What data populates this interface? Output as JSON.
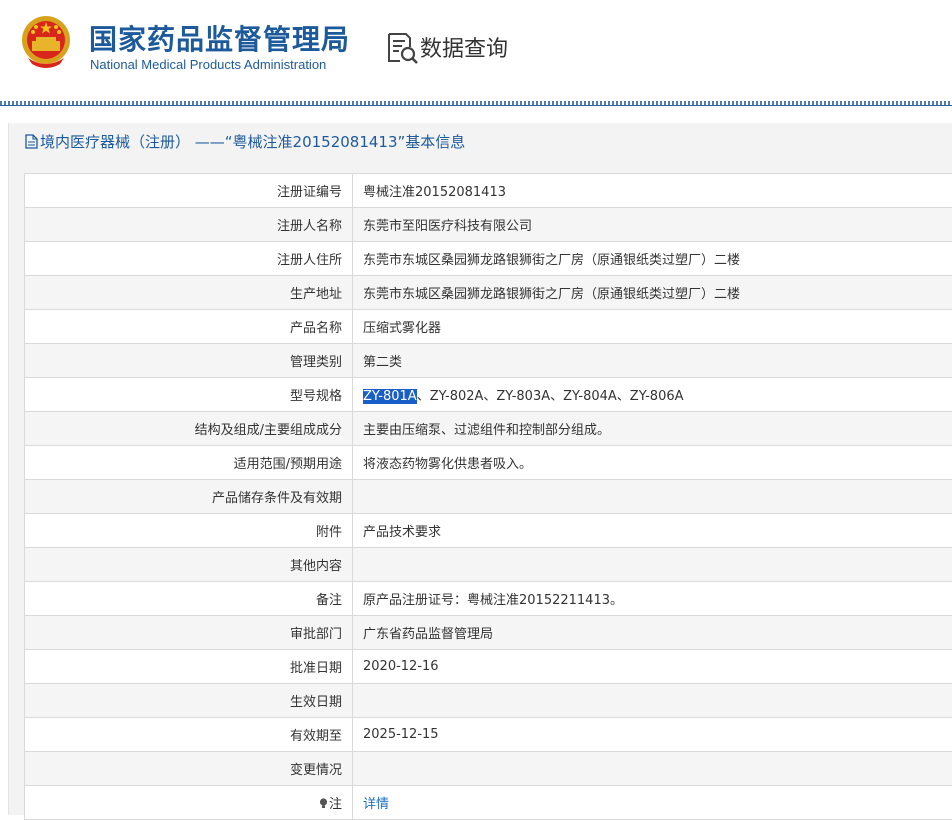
{
  "header": {
    "title_cn": "国家药品监督管理局",
    "title_en": "National Medical Products Administration",
    "query_label": "数据查询"
  },
  "colors": {
    "brand": "#1d5a9c",
    "link": "#1a6fc2",
    "highlight": "#1a5fc7"
  },
  "icons": {
    "emblem": "national-emblem",
    "query": "document-search-icon",
    "doc": "document-icon",
    "bulb": "lightbulb-icon"
  },
  "panel": {
    "title": "境内医疗器械（注册） ——“粤械注准20152081413”基本信息"
  },
  "rows": [
    {
      "label": "注册证编号",
      "value": "粤械注准20152081413"
    },
    {
      "label": "注册人名称",
      "value": "东莞市至阳医疗科技有限公司"
    },
    {
      "label": "注册人住所",
      "value": "东莞市东城区桑园狮龙路银狮街之厂房（原通银纸类过塑厂）二楼"
    },
    {
      "label": "生产地址",
      "value": "东莞市东城区桑园狮龙路银狮街之厂房（原通银纸类过塑厂）二楼"
    },
    {
      "label": "产品名称",
      "value": "压缩式雾化器"
    },
    {
      "label": "管理类别",
      "value": "第二类"
    },
    {
      "label": "型号规格",
      "value_selected": "ZY-801A",
      "value_rest": "、ZY-802A、ZY-803A、ZY-804A、ZY-806A"
    },
    {
      "label": "结构及组成/主要组成成分",
      "value": "主要由压缩泵、过滤组件和控制部分组成。"
    },
    {
      "label": "适用范围/预期用途",
      "value": "将液态药物雾化供患者吸入。"
    },
    {
      "label": "产品储存条件及有效期",
      "value": ""
    },
    {
      "label": "附件",
      "value": "产品技术要求"
    },
    {
      "label": "其他内容",
      "value": ""
    },
    {
      "label": "备注",
      "value": "原产品注册证号：粤械注准20152211413。"
    },
    {
      "label": "审批部门",
      "value": "广东省药品监督管理局"
    },
    {
      "label": "批准日期",
      "value": "2020-12-16"
    },
    {
      "label": "生效日期",
      "value": ""
    },
    {
      "label": "有效期至",
      "value": "2025-12-15"
    },
    {
      "label": "变更情况",
      "value": ""
    },
    {
      "label": "注",
      "value": "详情"
    }
  ]
}
